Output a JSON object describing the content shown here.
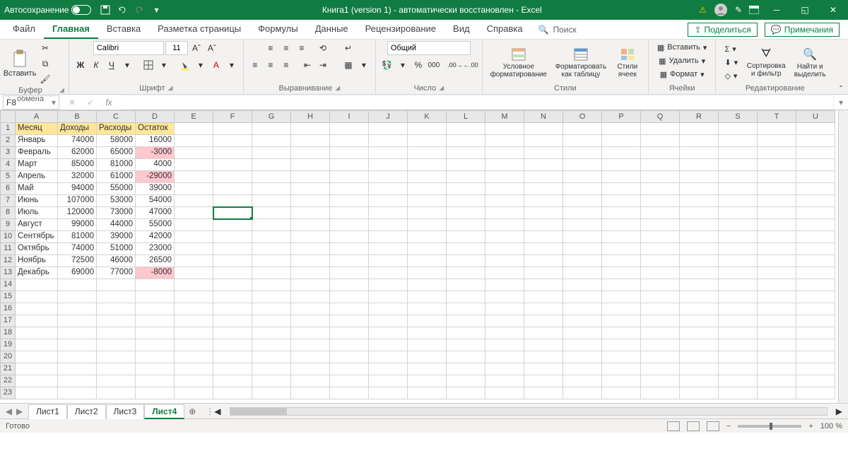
{
  "titlebar": {
    "autosave": "Автосохранение",
    "title": "Книга1 (version 1)  -  автоматически восстановлен  -  Excel"
  },
  "tabs": {
    "items": [
      "Файл",
      "Главная",
      "Вставка",
      "Разметка страницы",
      "Формулы",
      "Данные",
      "Рецензирование",
      "Вид",
      "Справка"
    ],
    "active": 1,
    "search_placeholder": "Поиск",
    "share": "Поделиться",
    "comments": "Примечания"
  },
  "ribbon": {
    "clipboard": {
      "paste": "Вставить",
      "label": "Буфер обмена"
    },
    "font": {
      "family": "Calibri",
      "size": "11",
      "bold": "Ж",
      "italic": "К",
      "underline": "Ч",
      "label": "Шрифт"
    },
    "align": {
      "label": "Выравнивание"
    },
    "number": {
      "format": "Общий",
      "label": "Число"
    },
    "styles": {
      "cond": "Условное форматирование",
      "table": "Форматировать как таблицу",
      "cell": "Стили ячеек",
      "label": "Стили"
    },
    "cells": {
      "insert": "Вставить",
      "delete": "Удалить",
      "format": "Формат",
      "label": "Ячейки"
    },
    "editing": {
      "sort": "Сортировка и фильтр",
      "find": "Найти и выделить",
      "label": "Редактирование"
    }
  },
  "namebox": "F8",
  "columns": [
    "A",
    "B",
    "C",
    "D",
    "E",
    "F",
    "G",
    "H",
    "I",
    "J",
    "K",
    "L",
    "M",
    "N",
    "O",
    "P",
    "Q",
    "R",
    "S",
    "T",
    "U"
  ],
  "header_row": [
    "Месяц",
    "Доходы",
    "Расходы",
    "Остаток"
  ],
  "data_rows": [
    {
      "m": "Январь",
      "i": 74000,
      "e": 58000,
      "r": 16000,
      "neg": false
    },
    {
      "m": "Февраль",
      "i": 62000,
      "e": 65000,
      "r": -3000,
      "neg": true
    },
    {
      "m": "Март",
      "i": 85000,
      "e": 81000,
      "r": 4000,
      "neg": false
    },
    {
      "m": "Апрель",
      "i": 32000,
      "e": 61000,
      "r": -29000,
      "neg": true
    },
    {
      "m": "Май",
      "i": 94000,
      "e": 55000,
      "r": 39000,
      "neg": false
    },
    {
      "m": "Июнь",
      "i": 107000,
      "e": 53000,
      "r": 54000,
      "neg": false
    },
    {
      "m": "Июль",
      "i": 120000,
      "e": 73000,
      "r": 47000,
      "neg": false
    },
    {
      "m": "Август",
      "i": 99000,
      "e": 44000,
      "r": 55000,
      "neg": false
    },
    {
      "m": "Сентябрь",
      "i": 81000,
      "e": 39000,
      "r": 42000,
      "neg": false
    },
    {
      "m": "Октябрь",
      "i": 74000,
      "e": 51000,
      "r": 23000,
      "neg": false
    },
    {
      "m": "Ноябрь",
      "i": 72500,
      "e": 46000,
      "r": 26500,
      "neg": false
    },
    {
      "m": "Декабрь",
      "i": 69000,
      "e": 77000,
      "r": -8000,
      "neg": true
    }
  ],
  "empty_rows": 10,
  "selected_cell": "F8",
  "sheets": {
    "items": [
      "Лист1",
      "Лист2",
      "Лист3",
      "Лист4"
    ],
    "active": 3
  },
  "status": {
    "ready": "Готово",
    "zoom": "100 %"
  }
}
